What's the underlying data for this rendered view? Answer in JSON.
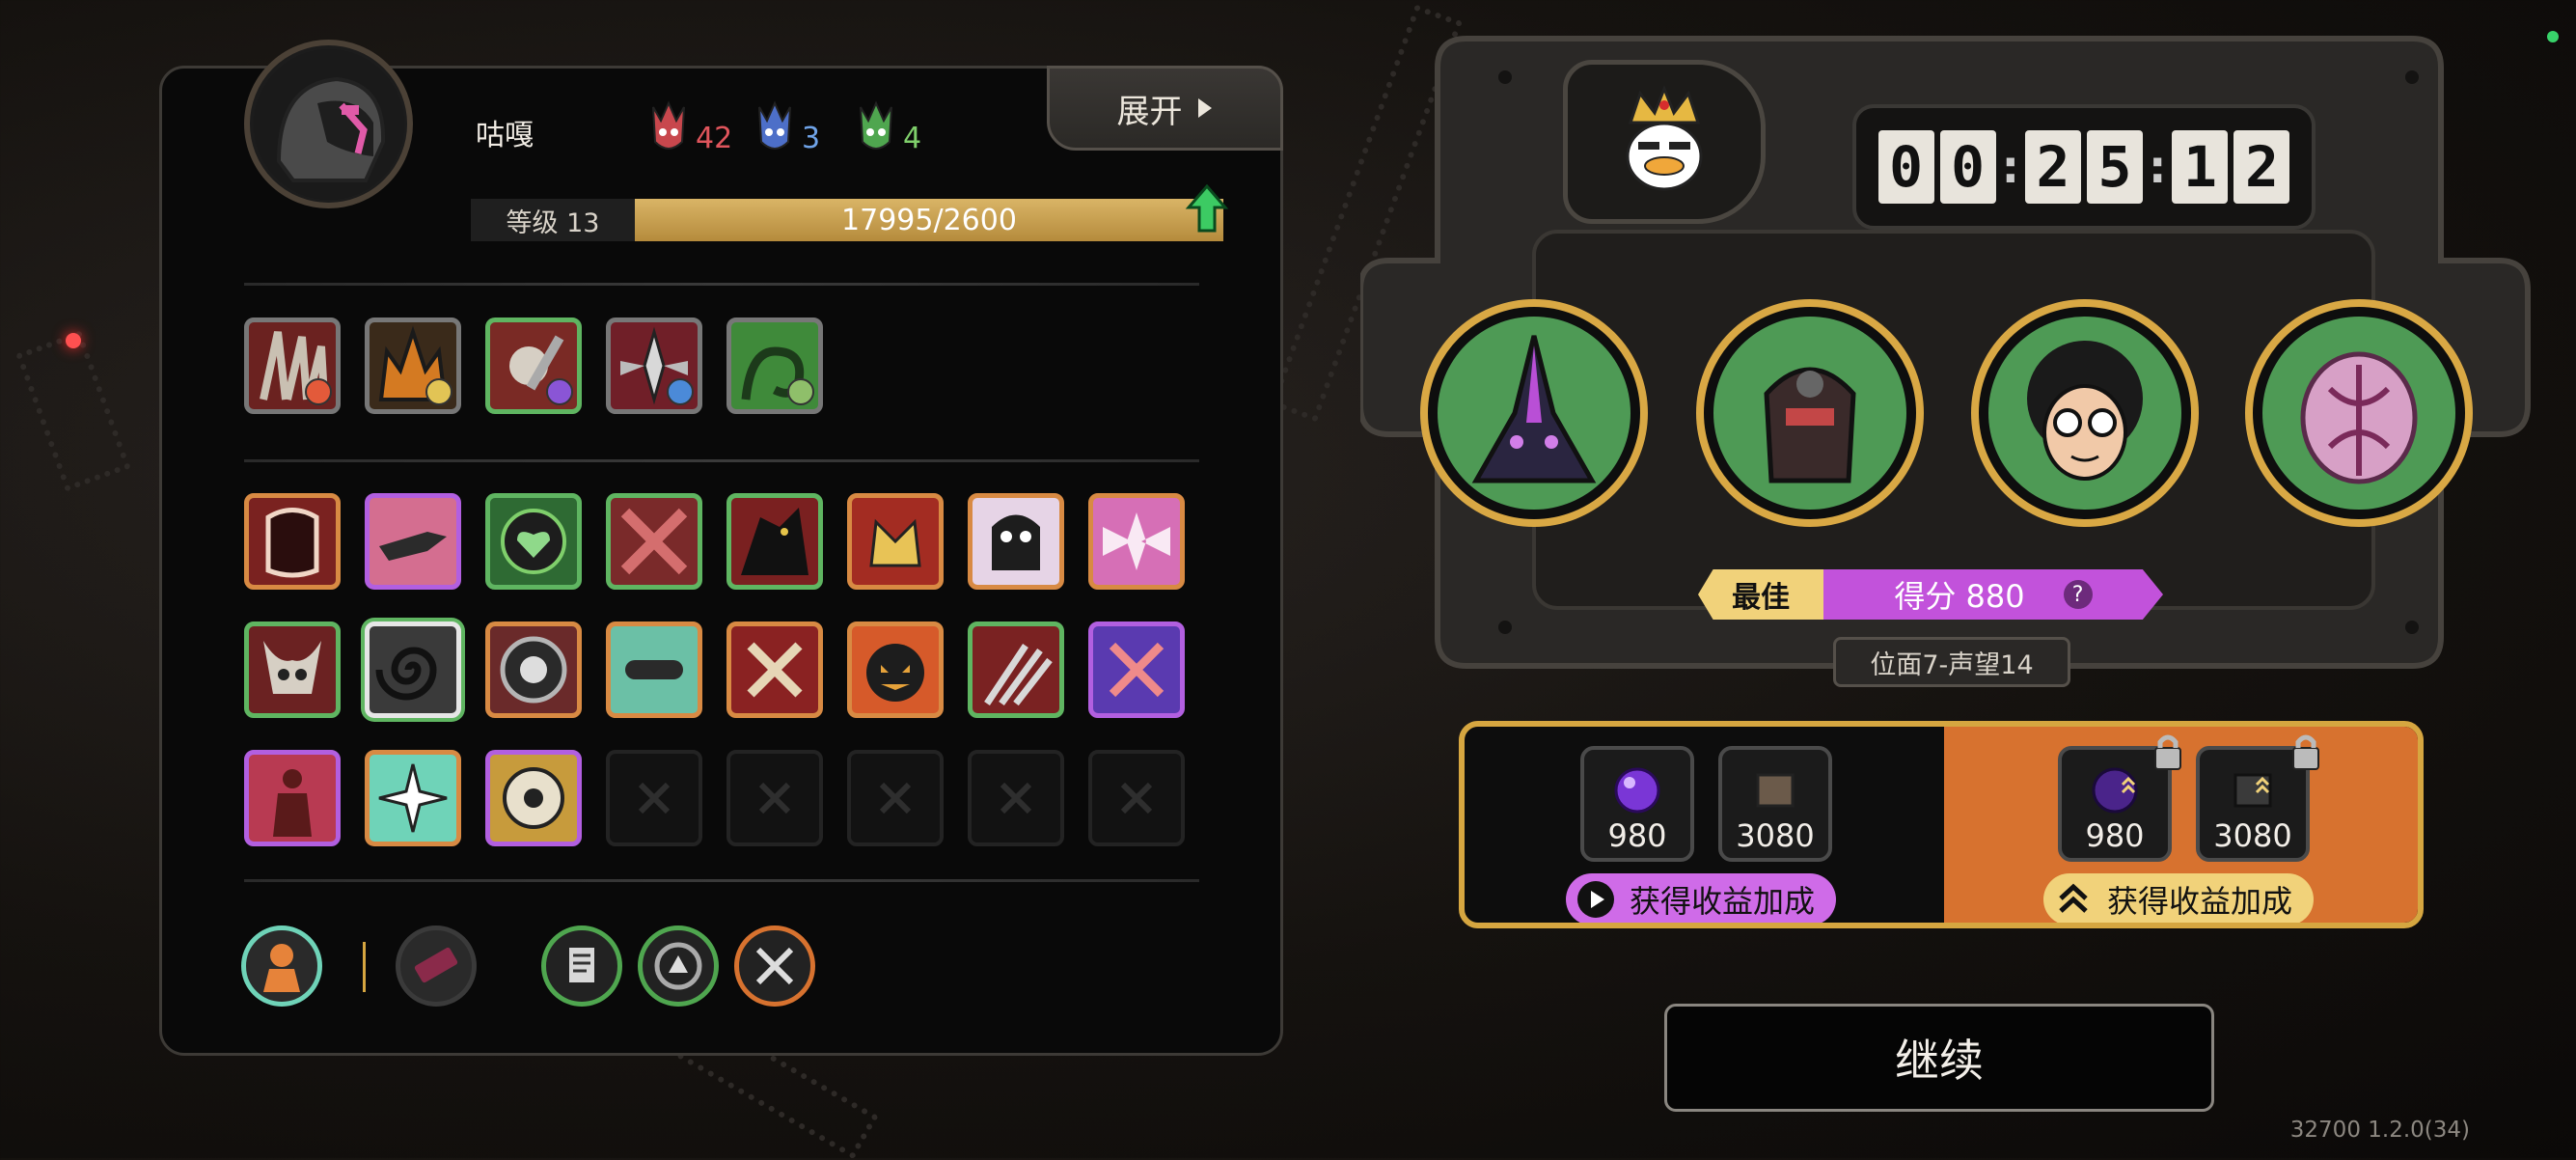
{
  "player": {
    "name": "咕嘎",
    "level_label": "等级 13",
    "xp_text": "17995/2600",
    "expand_label": "展开"
  },
  "resources": [
    {
      "icon": "red-mask-icon",
      "value": "42",
      "color": "#e0555c"
    },
    {
      "icon": "blue-mask-icon",
      "value": "3",
      "color": "#6fa3e8"
    },
    {
      "icon": "green-mask-icon",
      "value": "4",
      "color": "#7fcf6b"
    }
  ],
  "timer": {
    "digits": [
      "0",
      "0",
      "2",
      "5",
      "1",
      "2"
    ]
  },
  "score": {
    "best_label": "最佳",
    "score_text": "得分 880",
    "help": "?"
  },
  "plane_label": "位面7-声望14",
  "rewards": {
    "base": [
      {
        "icon": "purple-orb-icon",
        "value": "980"
      },
      {
        "icon": "book-icon",
        "value": "3080"
      }
    ],
    "bonus": [
      {
        "icon": "purple-orb-icon",
        "value": "980"
      },
      {
        "icon": "book-icon",
        "value": "3080"
      }
    ],
    "base_action": "获得收益加成",
    "bonus_action": "获得收益加成"
  },
  "continue_label": "继续",
  "version": "32700 1.2.0(34)",
  "colors": {
    "gold": "#d6a640",
    "accent_purple": "#c252db",
    "accent_orange": "#d7722f",
    "green": "#5fb561"
  }
}
